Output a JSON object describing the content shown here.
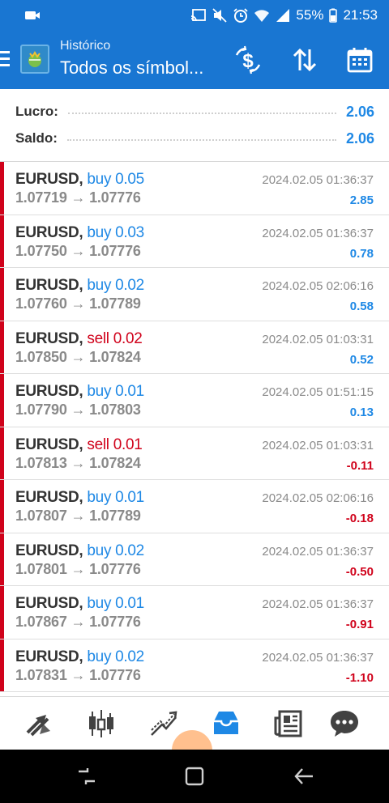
{
  "status_bar": {
    "battery": "55%",
    "time": "21:53"
  },
  "app_bar": {
    "subtitle": "Histórico",
    "title": "Todos os símbol..."
  },
  "summary": {
    "profit_label": "Lucro:",
    "profit_value": "2.06",
    "balance_label": "Saldo:",
    "balance_value": "2.06"
  },
  "trades": [
    {
      "symbol": "EURUSD,",
      "side": "buy 0.05",
      "type": "buy",
      "prices": "1.07719 → 1.07776",
      "time": "2024.02.05 01:36:37",
      "profit": "2.85"
    },
    {
      "symbol": "EURUSD,",
      "side": "buy 0.03",
      "type": "buy",
      "prices": "1.07750 → 1.07776",
      "time": "2024.02.05 01:36:37",
      "profit": "0.78"
    },
    {
      "symbol": "EURUSD,",
      "side": "buy 0.02",
      "type": "buy",
      "prices": "1.07760 → 1.07789",
      "time": "2024.02.05 02:06:16",
      "profit": "0.58"
    },
    {
      "symbol": "EURUSD,",
      "side": "sell 0.02",
      "type": "sell",
      "prices": "1.07850 → 1.07824",
      "time": "2024.02.05 01:03:31",
      "profit": "0.52"
    },
    {
      "symbol": "EURUSD,",
      "side": "buy 0.01",
      "type": "buy",
      "prices": "1.07790 → 1.07803",
      "time": "2024.02.05 01:51:15",
      "profit": "0.13"
    },
    {
      "symbol": "EURUSD,",
      "side": "sell 0.01",
      "type": "sell",
      "prices": "1.07813 → 1.07824",
      "time": "2024.02.05 01:03:31",
      "profit": "-0.11"
    },
    {
      "symbol": "EURUSD,",
      "side": "buy 0.01",
      "type": "buy",
      "prices": "1.07807 → 1.07789",
      "time": "2024.02.05 02:06:16",
      "profit": "-0.18"
    },
    {
      "symbol": "EURUSD,",
      "side": "buy 0.02",
      "type": "buy",
      "prices": "1.07801 → 1.07776",
      "time": "2024.02.05 01:36:37",
      "profit": "-0.50"
    },
    {
      "symbol": "EURUSD,",
      "side": "buy 0.01",
      "type": "buy",
      "prices": "1.07867 → 1.07776",
      "time": "2024.02.05 01:36:37",
      "profit": "-0.91"
    },
    {
      "symbol": "EURUSD,",
      "side": "buy 0.02",
      "type": "buy",
      "prices": "1.07831 → 1.07776",
      "time": "2024.02.05 01:36:37",
      "profit": "-1.10"
    }
  ],
  "colors": {
    "primary": "#1976d2",
    "positive": "#1e88e5",
    "negative": "#d0021b",
    "active_tab": "#1e88e5",
    "inactive_tab": "#424242"
  },
  "icons": {
    "toolbar": [
      "deposit-icon",
      "sort-icon",
      "calendar-icon"
    ],
    "bottom_nav": [
      "quotes-icon",
      "chart-icon",
      "trade-icon",
      "history-icon",
      "news-icon",
      "chat-icon"
    ]
  }
}
